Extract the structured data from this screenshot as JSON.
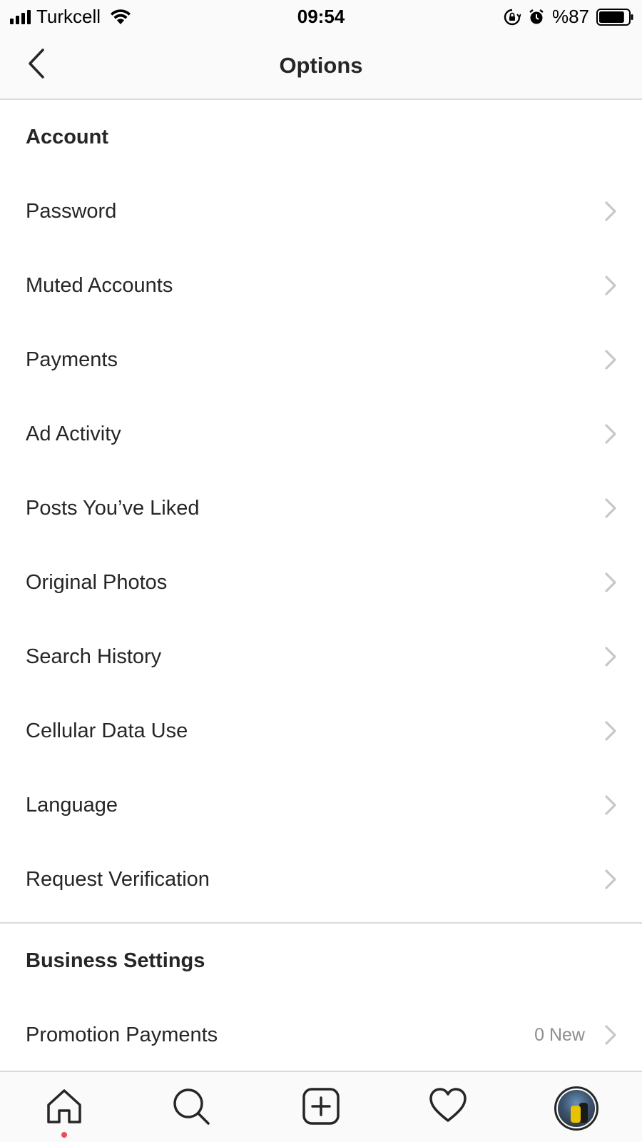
{
  "status_bar": {
    "carrier": "Turkcell",
    "time": "09:54",
    "battery_pct": "%87",
    "battery_level": 0.87
  },
  "header": {
    "title": "Options"
  },
  "sections": {
    "account": {
      "title": "Account",
      "items": [
        {
          "label": "Password"
        },
        {
          "label": "Muted Accounts"
        },
        {
          "label": "Payments"
        },
        {
          "label": "Ad Activity"
        },
        {
          "label": "Posts You’ve Liked"
        },
        {
          "label": "Original Photos"
        },
        {
          "label": "Search History"
        },
        {
          "label": "Cellular Data Use"
        },
        {
          "label": "Language"
        },
        {
          "label": "Request Verification"
        }
      ]
    },
    "business": {
      "title": "Business Settings",
      "items": [
        {
          "label": "Promotion Payments",
          "meta": "0 New"
        }
      ]
    }
  },
  "tab_bar": {
    "tabs": [
      "home-icon",
      "search-icon",
      "new-post-icon",
      "activity-heart-icon",
      "profile-avatar"
    ],
    "notification_color": "#ed4956"
  }
}
